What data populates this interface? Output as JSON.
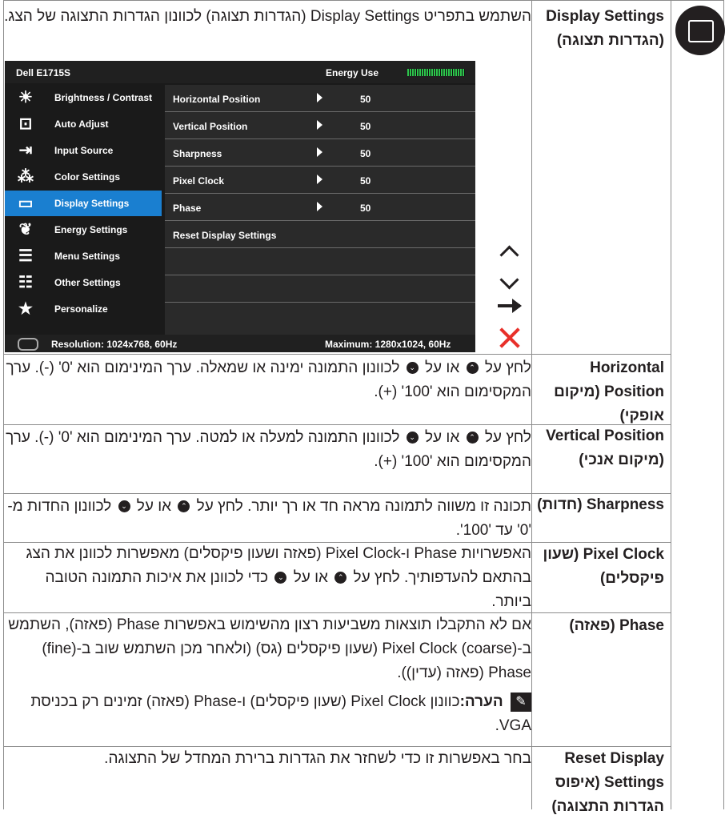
{
  "rows": [
    {
      "term": "Display Settings (הגדרות תצוגה)",
      "desc": "השתמש בתפריט Display Settings (הגדרות תצוגה) לכוונון הגדרות התצוגה של הצג."
    },
    {
      "term": "Horizontal Position (מיקום אופקי)",
      "desc_a": "לחץ על",
      "desc_b": "או על",
      "desc_c": "לכוונון התמונה ימינה או שמאלה. ערך המינימום הוא '0' (-). ערך המקסימום הוא '100' (+)."
    },
    {
      "term": "Vertical Position (מיקום אנכי)",
      "desc_a": "לחץ על",
      "desc_b": "או על",
      "desc_c": "לכוונון התמונה למעלה או למטה. ערך המינימום הוא '0' (-). ערך המקסימום הוא '100' (+)."
    },
    {
      "term": "Sharpness (חדות)",
      "desc_a": "תכונה זו משווה לתמונה מראה חד או רך יותר. לחץ על",
      "desc_b": "או על",
      "desc_c": "לכוונון החדות מ-'0' עד '100'."
    },
    {
      "term": "Pixel Clock (שעון פיקסלים)",
      "desc_a": "האפשרויות Phase ו-Pixel Clock (פאזה ושעון פיקסלים) מאפשרות לכוונן את הצג בהתאם להעדפותיך. לחץ על",
      "desc_b": "או על",
      "desc_c": "כדי לכוונן את איכות התמונה הטובה ביותר."
    },
    {
      "term": "Phase (פאזה)",
      "desc": "אם לא התקבלו תוצאות משביעות רצון מהשימוש באפשרות Phase (פאזה), השתמש ב-(coarse) Pixel Clock (שעון פיקסלים (גס) (ולאחר מכן השתמש שוב ב-(fine) Phase (פאזה (עדין)).",
      "note_label": "הערה:",
      "note": "כוונון Pixel Clock (שעון פיקסלים) ו-Phase (פאזה) זמינים רק בכניסת VGA."
    },
    {
      "term": "Reset Display Settings (איפוס הגדרות התצוגה)",
      "desc": "בחר באפשרות זו כדי לשחזר את הגדרות ברירת המחדל של התצוגה."
    }
  ],
  "osd": {
    "model": "Dell E1715S",
    "energy_label": "Energy Use",
    "menu": [
      {
        "label": "Brightness / Contrast",
        "icon": "brightness-icon"
      },
      {
        "label": "Auto Adjust",
        "icon": "auto-adjust-icon"
      },
      {
        "label": "Input Source",
        "icon": "input-source-icon"
      },
      {
        "label": "Color Settings",
        "icon": "color-settings-icon"
      },
      {
        "label": "Display Settings",
        "icon": "display-settings-icon",
        "active": true
      },
      {
        "label": "Energy Settings",
        "icon": "energy-settings-icon"
      },
      {
        "label": "Menu Settings",
        "icon": "menu-settings-icon"
      },
      {
        "label": "Other Settings",
        "icon": "other-settings-icon"
      },
      {
        "label": "Personalize",
        "icon": "star-icon"
      }
    ],
    "items": [
      {
        "label": "Horizontal Position",
        "value": "50"
      },
      {
        "label": "Vertical Position",
        "value": "50"
      },
      {
        "label": "Sharpness",
        "value": "50"
      },
      {
        "label": "Pixel Clock",
        "value": "50"
      },
      {
        "label": "Phase",
        "value": "50"
      },
      {
        "label": "Reset Display Settings",
        "value": ""
      }
    ],
    "resolution": "Resolution: 1024x768, 60Hz",
    "maximum": "Maximum: 1280x1024, 60Hz"
  },
  "colors": {
    "active_item": "#1a7fd0",
    "meter": "#2dc44c",
    "close": "#e8302a"
  }
}
